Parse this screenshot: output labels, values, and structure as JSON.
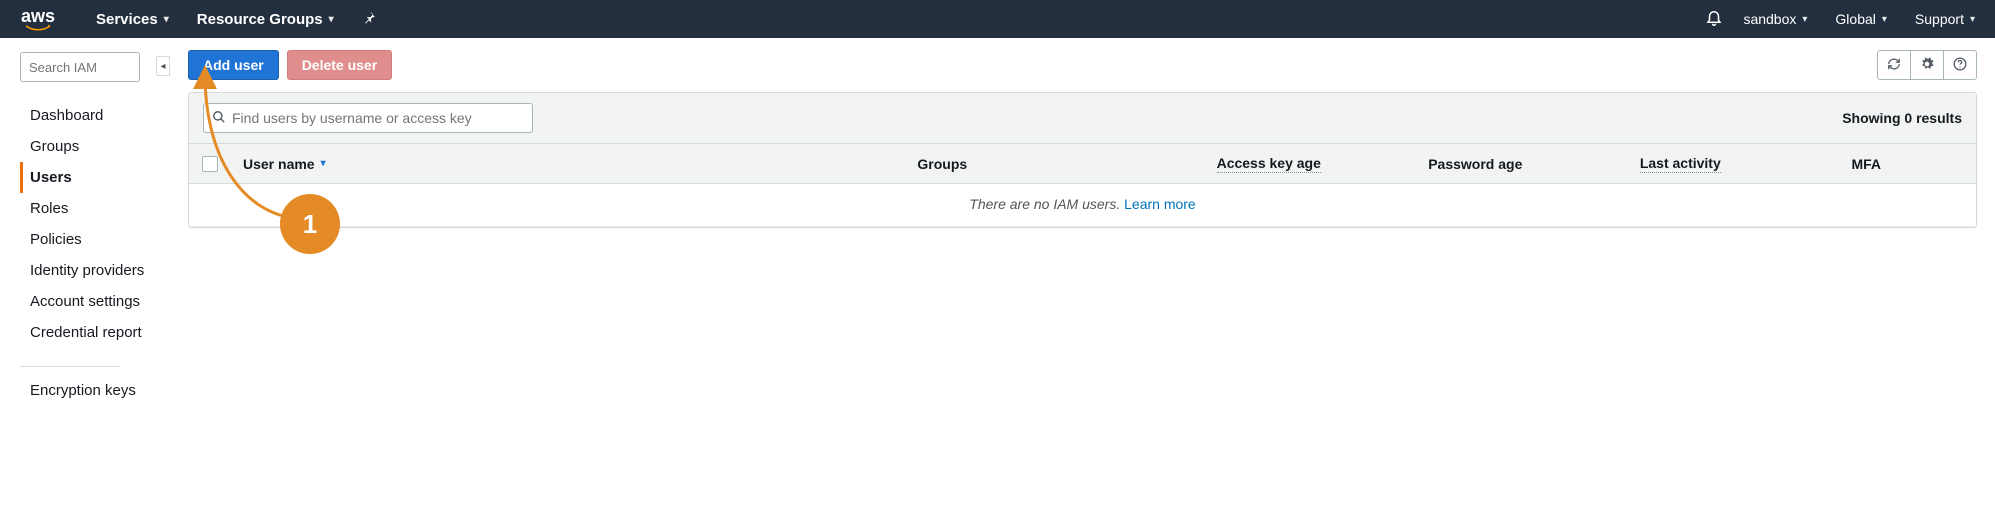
{
  "topnav": {
    "logo": "aws",
    "services": "Services",
    "resource_groups": "Resource Groups",
    "account": "sandbox",
    "region": "Global",
    "support": "Support"
  },
  "sidebar": {
    "search_placeholder": "Search IAM",
    "items": [
      {
        "label": "Dashboard",
        "active": false
      },
      {
        "label": "Groups",
        "active": false
      },
      {
        "label": "Users",
        "active": true
      },
      {
        "label": "Roles",
        "active": false
      },
      {
        "label": "Policies",
        "active": false
      },
      {
        "label": "Identity providers",
        "active": false
      },
      {
        "label": "Account settings",
        "active": false
      },
      {
        "label": "Credential report",
        "active": false
      }
    ],
    "secondary_items": [
      {
        "label": "Encryption keys"
      }
    ]
  },
  "actions": {
    "add_user": "Add user",
    "delete_user": "Delete user"
  },
  "filter": {
    "placeholder": "Find users by username or access key"
  },
  "results": {
    "text": "Showing 0 results"
  },
  "columns": {
    "username": "User name",
    "groups": "Groups",
    "access_key_age": "Access key age",
    "password_age": "Password age",
    "last_activity": "Last activity",
    "mfa": "MFA"
  },
  "empty": {
    "message": "There are no IAM users.",
    "learn_more": "Learn more"
  },
  "annotation": {
    "badge": "1"
  }
}
